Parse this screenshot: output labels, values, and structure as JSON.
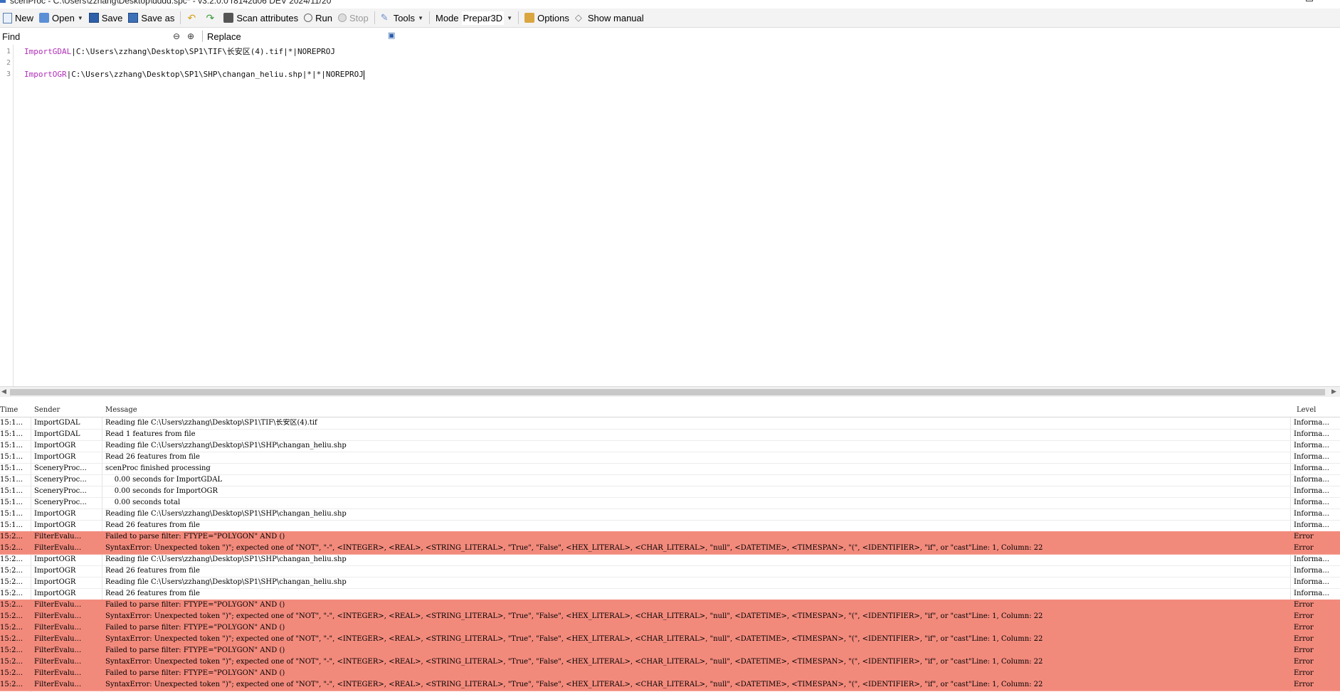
{
  "window": {
    "title": "scenProc - C:\\Users\\zzhang\\Desktop\\dddd.spc* - v3.2.0.0 r8142d06 DEV 2024/11/20"
  },
  "toolbar": {
    "new": "New",
    "open": "Open",
    "save": "Save",
    "save_as": "Save as",
    "scan_attributes": "Scan attributes",
    "run": "Run",
    "stop": "Stop",
    "tools": "Tools",
    "mode_label": "Mode",
    "mode_value": "Prepar3D",
    "options": "Options",
    "show_manual": "Show manual"
  },
  "find": {
    "placeholder": "Find",
    "replace": "Replace"
  },
  "editor": {
    "lines": [
      {
        "number": "1",
        "keyword": "ImportGDAL",
        "rest": "|C:\\Users\\zzhang\\Desktop\\SP1\\TIF\\长安区(4).tif|*|NOREPROJ"
      },
      {
        "number": "2",
        "keyword": "",
        "rest": ""
      },
      {
        "number": "3",
        "keyword": "ImportOGR",
        "rest": "|C:\\Users\\zzhang\\Desktop\\SP1\\SHP\\changan_heliu.shp|*|*|NOREPROJ"
      }
    ]
  },
  "log": {
    "columns": {
      "time": "Time",
      "sender": "Sender",
      "message": "Message",
      "level": "Level"
    },
    "rows": [
      {
        "time": "15:1...",
        "sender": "ImportGDAL",
        "message": "Reading file C:\\Users\\zzhang\\Desktop\\SP1\\TIF\\长安区(4).tif",
        "level": "Informa...",
        "error": false
      },
      {
        "time": "15:1...",
        "sender": "ImportGDAL",
        "message": "Read 1 features from file",
        "level": "Informa...",
        "error": false
      },
      {
        "time": "15:1...",
        "sender": "ImportOGR",
        "message": "Reading file C:\\Users\\zzhang\\Desktop\\SP1\\SHP\\changan_heliu.shp",
        "level": "Informa...",
        "error": false
      },
      {
        "time": "15:1...",
        "sender": "ImportOGR",
        "message": "Read 26 features from file",
        "level": "Informa...",
        "error": false
      },
      {
        "time": "15:1...",
        "sender": "SceneryProc...",
        "message": "scenProc finished processing",
        "level": "Informa...",
        "error": false
      },
      {
        "time": "15:1...",
        "sender": "SceneryProc...",
        "message": "    0.00 seconds for ImportGDAL",
        "level": "Informa...",
        "error": false
      },
      {
        "time": "15:1...",
        "sender": "SceneryProc...",
        "message": "    0.00 seconds for ImportOGR",
        "level": "Informa...",
        "error": false
      },
      {
        "time": "15:1...",
        "sender": "SceneryProc...",
        "message": "    0.00 seconds total",
        "level": "Informa...",
        "error": false
      },
      {
        "time": "15:1...",
        "sender": "ImportOGR",
        "message": "Reading file C:\\Users\\zzhang\\Desktop\\SP1\\SHP\\changan_heliu.shp",
        "level": "Informa...",
        "error": false
      },
      {
        "time": "15:1...",
        "sender": "ImportOGR",
        "message": "Read 26 features from file",
        "level": "Informa...",
        "error": false
      },
      {
        "time": "15:2...",
        "sender": "FilterEvalu...",
        "message": "Failed to parse filter: FTYPE=\"POLYGON\" AND ()",
        "level": "Error",
        "error": true
      },
      {
        "time": "15:2...",
        "sender": "FilterEvalu...",
        "message": "SyntaxError: Unexpected token \")\"; expected one of \"NOT\", \"-\", <INTEGER>, <REAL>, <STRING_LITERAL>, \"True\", \"False\", <HEX_LITERAL>, <CHAR_LITERAL>, \"null\", <DATETIME>, <TIMESPAN>, \"(\", <IDENTIFIER>, \"if\", or \"cast\"Line: 1, Column: 22",
        "level": "Error",
        "error": true
      },
      {
        "time": "15:2...",
        "sender": "ImportOGR",
        "message": "Reading file C:\\Users\\zzhang\\Desktop\\SP1\\SHP\\changan_heliu.shp",
        "level": "Informa...",
        "error": false
      },
      {
        "time": "15:2...",
        "sender": "ImportOGR",
        "message": "Read 26 features from file",
        "level": "Informa...",
        "error": false
      },
      {
        "time": "15:2...",
        "sender": "ImportOGR",
        "message": "Reading file C:\\Users\\zzhang\\Desktop\\SP1\\SHP\\changan_heliu.shp",
        "level": "Informa...",
        "error": false
      },
      {
        "time": "15:2...",
        "sender": "ImportOGR",
        "message": "Read 26 features from file",
        "level": "Informa...",
        "error": false
      },
      {
        "time": "15:2...",
        "sender": "FilterEvalu...",
        "message": "Failed to parse filter: FTYPE=\"POLYGON\" AND ()",
        "level": "Error",
        "error": true
      },
      {
        "time": "15:2...",
        "sender": "FilterEvalu...",
        "message": "SyntaxError: Unexpected token \")\"; expected one of \"NOT\", \"-\", <INTEGER>, <REAL>, <STRING_LITERAL>, \"True\", \"False\", <HEX_LITERAL>, <CHAR_LITERAL>, \"null\", <DATETIME>, <TIMESPAN>, \"(\", <IDENTIFIER>, \"if\", or \"cast\"Line: 1, Column: 22",
        "level": "Error",
        "error": true
      },
      {
        "time": "15:2...",
        "sender": "FilterEvalu...",
        "message": "Failed to parse filter: FTYPE=\"POLYGON\" AND ()",
        "level": "Error",
        "error": true
      },
      {
        "time": "15:2...",
        "sender": "FilterEvalu...",
        "message": "SyntaxError: Unexpected token \")\"; expected one of \"NOT\", \"-\", <INTEGER>, <REAL>, <STRING_LITERAL>, \"True\", \"False\", <HEX_LITERAL>, <CHAR_LITERAL>, \"null\", <DATETIME>, <TIMESPAN>, \"(\", <IDENTIFIER>, \"if\", or \"cast\"Line: 1, Column: 22",
        "level": "Error",
        "error": true
      },
      {
        "time": "15:2...",
        "sender": "FilterEvalu...",
        "message": "Failed to parse filter: FTYPE=\"POLYGON\" AND ()",
        "level": "Error",
        "error": true
      },
      {
        "time": "15:2...",
        "sender": "FilterEvalu...",
        "message": "SyntaxError: Unexpected token \")\"; expected one of \"NOT\", \"-\", <INTEGER>, <REAL>, <STRING_LITERAL>, \"True\", \"False\", <HEX_LITERAL>, <CHAR_LITERAL>, \"null\", <DATETIME>, <TIMESPAN>, \"(\", <IDENTIFIER>, \"if\", or \"cast\"Line: 1, Column: 22",
        "level": "Error",
        "error": true
      },
      {
        "time": "15:2...",
        "sender": "FilterEvalu...",
        "message": "Failed to parse filter: FTYPE=\"POLYGON\" AND ()",
        "level": "Error",
        "error": true
      },
      {
        "time": "15:2...",
        "sender": "FilterEvalu...",
        "message": "SyntaxError: Unexpected token \")\"; expected one of \"NOT\", \"-\", <INTEGER>, <REAL>, <STRING_LITERAL>, \"True\", \"False\", <HEX_LITERAL>, <CHAR_LITERAL>, \"null\", <DATETIME>, <TIMESPAN>, \"(\", <IDENTIFIER>, \"if\", or \"cast\"Line: 1, Column: 22",
        "level": "Error",
        "error": true
      }
    ]
  },
  "colors": {
    "error_row": "#f28a7c",
    "keyword": "#b02fb8",
    "toolbar_bg": "#f3f3f3"
  },
  "icons": [
    "new-file-icon",
    "open-folder-icon",
    "save-icon",
    "save-as-icon",
    "undo-icon",
    "redo-icon",
    "scan-icon",
    "run-icon",
    "stop-icon",
    "tools-icon",
    "options-icon",
    "manual-icon",
    "find-previous-icon",
    "find-next-icon",
    "find-options-icon"
  ]
}
